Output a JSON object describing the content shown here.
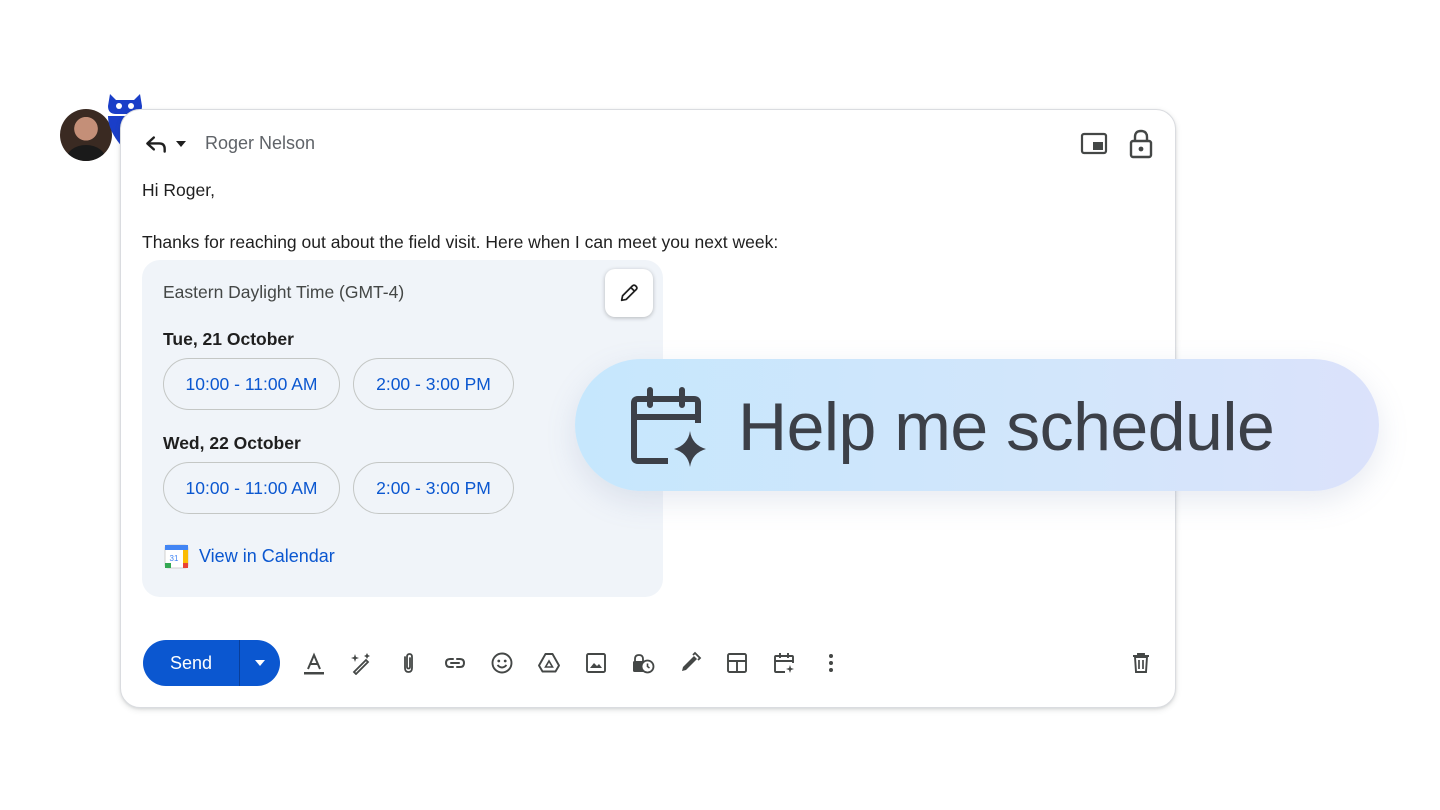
{
  "header": {
    "recipient_name": "Roger Nelson",
    "reply_icon": "reply-icon",
    "caret_icon": "caret-down-icon",
    "pip_icon": "picture-in-picture-icon",
    "lock_icon": "lock-icon"
  },
  "message": {
    "greeting": "Hi Roger,",
    "body": "Thanks for reaching out about the field visit. Here when I can meet you next week:"
  },
  "schedule_card": {
    "timezone": "Eastern Daylight Time (GMT-4)",
    "days": [
      {
        "label": "Tue, 21 October",
        "slots": [
          "10:00 - 11:00 AM",
          "2:00 - 3:00 PM"
        ]
      },
      {
        "label": "Wed, 22 October",
        "slots": [
          "10:00 - 11:00 AM",
          "2:00 - 3:00 PM"
        ]
      }
    ],
    "calendar_link": "View in Calendar",
    "calendar_icon_day": "31"
  },
  "toolbar": {
    "send_label": "Send",
    "icons": [
      "text-format-icon",
      "magic-pen-icon",
      "attach-icon",
      "link-icon",
      "emoji-icon",
      "drive-icon",
      "image-icon",
      "confidential-icon",
      "signature-icon",
      "layout-icon",
      "schedule-icon",
      "more-options-icon"
    ],
    "delete_icon": "trash-icon"
  },
  "feature_pill": {
    "label": "Help me schedule",
    "icon": "calendar-sparkle-icon"
  },
  "colors": {
    "accent": "#0b57d0",
    "card_bg": "#f0f4f9",
    "pill_start": "#c6e7fd",
    "pill_end": "#dbe2fb",
    "logo_blue": "#1a3ec8"
  }
}
